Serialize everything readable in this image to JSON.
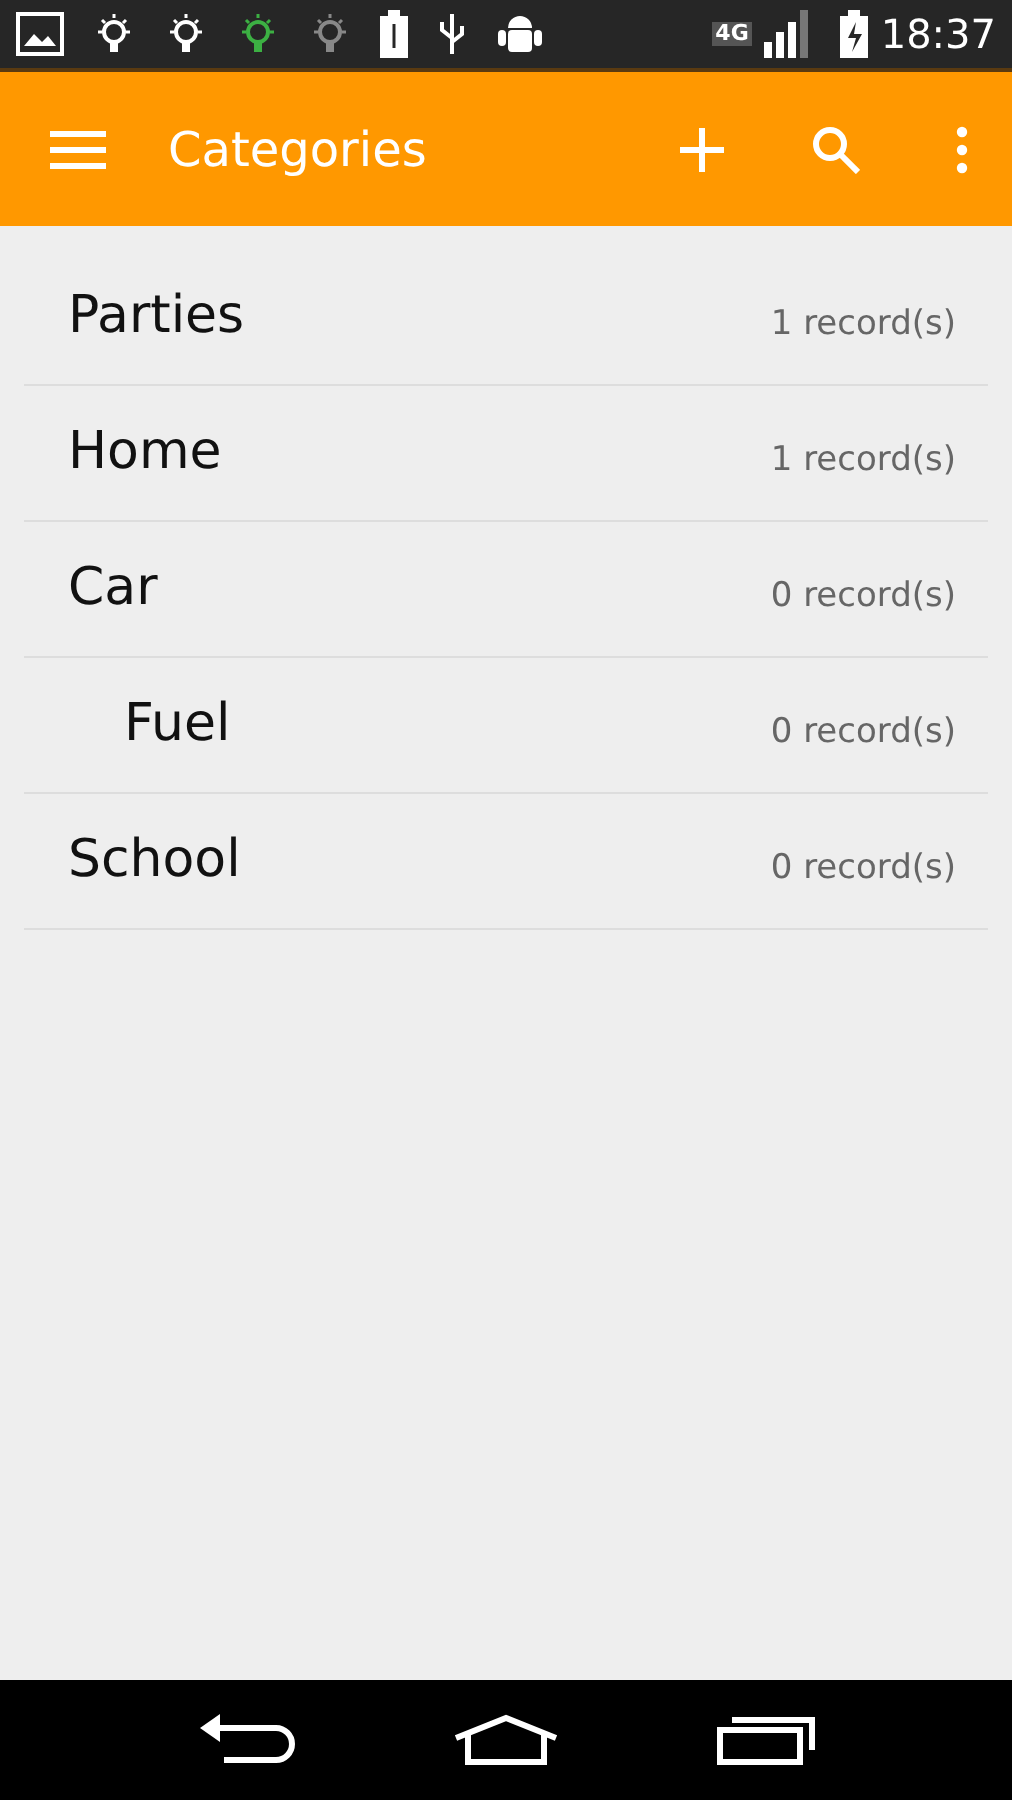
{
  "status_bar": {
    "network": "4G",
    "time": "18:37"
  },
  "toolbar": {
    "title": "Categories"
  },
  "categories": [
    {
      "name": "Parties",
      "count": "1 record(s)"
    },
    {
      "name": "Home",
      "count": "1 record(s)"
    },
    {
      "name": "Car",
      "count": "0 record(s)",
      "children": [
        {
          "name": "Fuel",
          "count": "0 record(s)"
        }
      ]
    },
    {
      "name": "School",
      "count": "0 record(s)"
    }
  ]
}
